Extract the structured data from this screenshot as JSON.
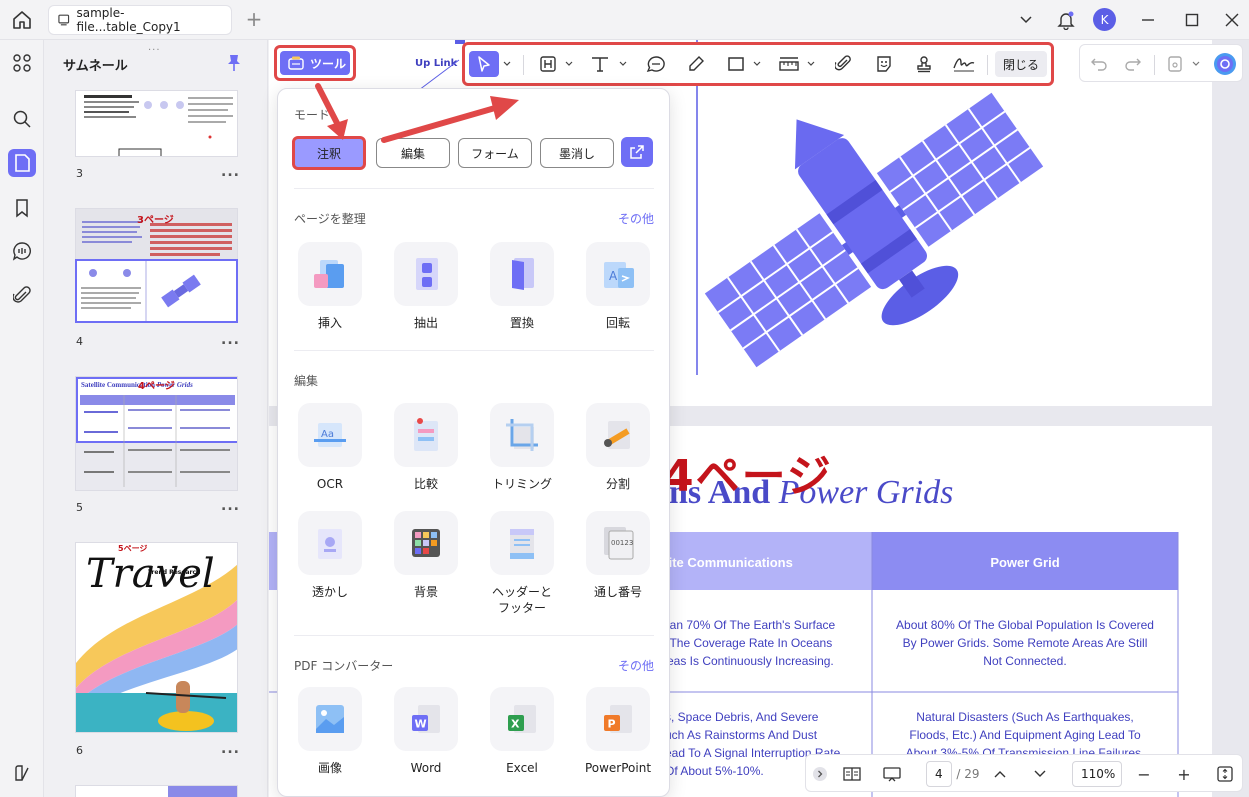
{
  "titlebar": {
    "tab_title": "sample-file...table_Copy1",
    "tab_add": "+",
    "avatar_initial": "K"
  },
  "thumbnails": {
    "title": "サムネール",
    "grip": "...",
    "pages": [
      {
        "number": "3",
        "more": "...",
        "overlay": ""
      },
      {
        "number": "4",
        "more": "...",
        "overlay": "3ページ"
      },
      {
        "number": "5",
        "more": "...",
        "overlay": "4ページ",
        "title": "Satellite Communication",
        "title_italic": "Power Grids"
      },
      {
        "number": "6",
        "more": "...",
        "overlay": "5ページ",
        "title": "Travel",
        "subtitle": "Trend Research"
      }
    ]
  },
  "toolbar": {
    "tools_label": "ツール",
    "close_label": "閉じる"
  },
  "panel": {
    "mode_title": "モード",
    "modes": [
      "注釈",
      "編集",
      "フォーム",
      "墨消し"
    ],
    "organize": {
      "title": "ページを整理",
      "more": "その他",
      "items": [
        "挿入",
        "抽出",
        "置換",
        "回転"
      ]
    },
    "edit": {
      "title": "編集",
      "items": [
        "OCR",
        "比較",
        "トリミング",
        "分割",
        "透かし",
        "背景",
        "ヘッダーと\nフッター",
        "通し番号"
      ]
    },
    "converter": {
      "title": "PDF コンバーター",
      "more": "その他",
      "items": [
        "画像",
        "Word",
        "Excel",
        "PowerPoint"
      ]
    }
  },
  "document": {
    "uplink": "Up Link",
    "page_label": "4ページ",
    "heading_bold": "ns And ",
    "heading_italic": "Power Grids",
    "table": {
      "headers": [
        "lite Communications",
        "Power Grid"
      ],
      "row1": [
        "han 70% Of The Earth's Surface\n. The Coverage Rate In Oceans\nreas Is Continuously Increasing.",
        "About 80% Of The Global Population Is Covered\nBy Power Grids. Some Remote Areas Are Still\nNot Connected."
      ],
      "row2": [
        "s, Space Debris, And Severe\nuch As Rainstorms And Dust\nead To A Signal Interruption Rate\nOf About 5%-10%.",
        "Natural Disasters (Such As Earthquakes,\nFloods, Etc.) And Equipment Aging Lead To\nAbout 3%-5% Of Transmission Line Failures."
      ]
    }
  },
  "statusbar": {
    "page_current": "4",
    "page_total": "/ 29",
    "zoom": "110%",
    "minus": "−",
    "plus": "+"
  },
  "colors": {
    "accent": "#6e6ef5",
    "highlight": "#e04848",
    "doc_text": "#3f3fbf",
    "annotation_red": "#c4141b"
  }
}
